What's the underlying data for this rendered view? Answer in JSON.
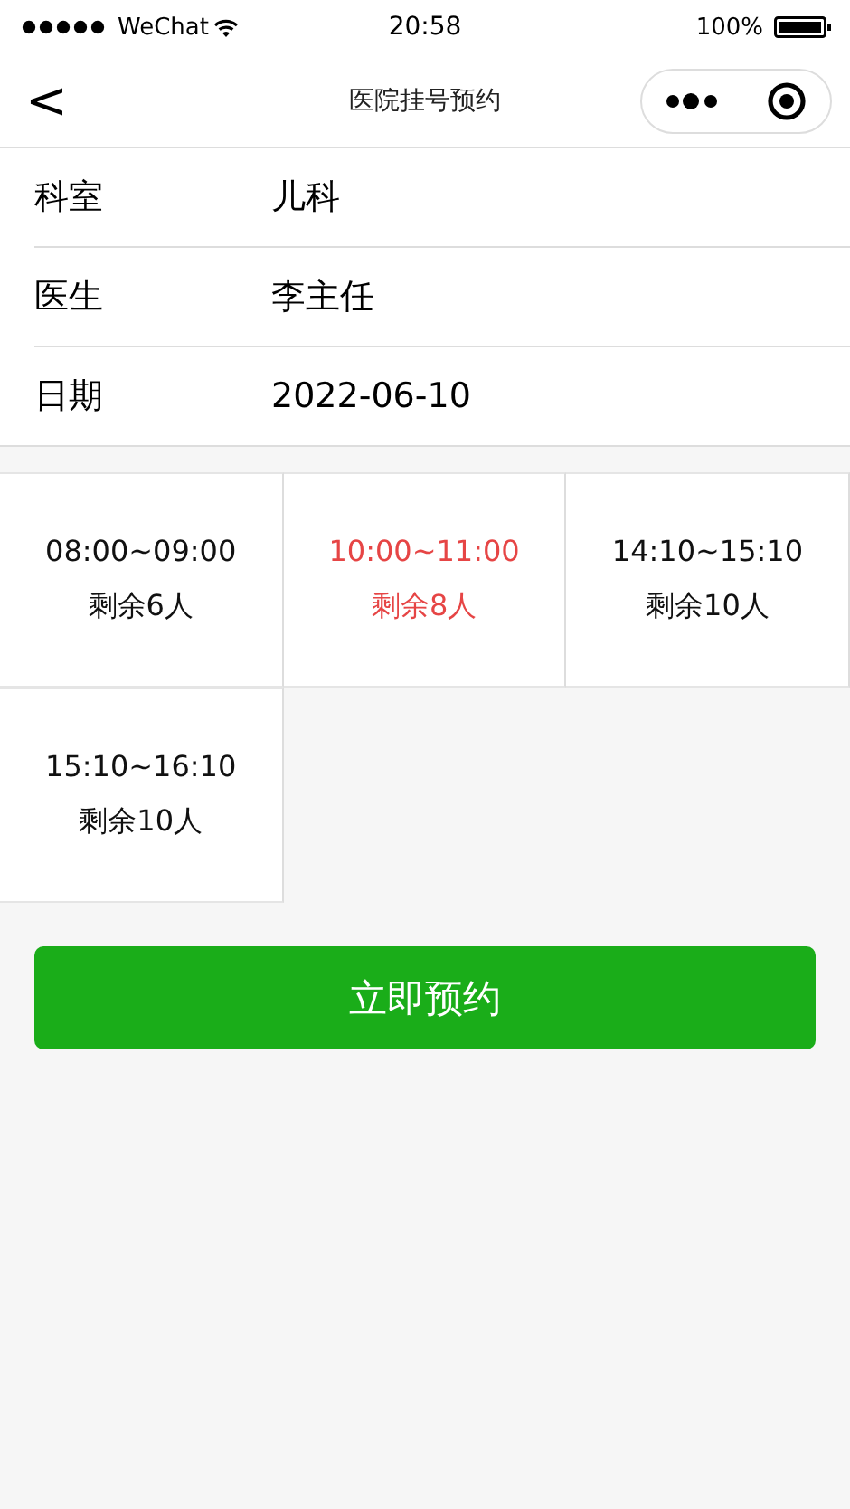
{
  "status_bar": {
    "carrier": "WeChat",
    "time": "20:58",
    "battery": "100%"
  },
  "nav_bar": {
    "back": "<",
    "title": "医院挂号预约"
  },
  "form": [
    {
      "label": "科室",
      "value": "儿科"
    },
    {
      "label": "医生",
      "value": "李主任"
    },
    {
      "label": "日期",
      "value": "2022-06-10"
    }
  ],
  "slots": [
    {
      "time": "08:00~09:00",
      "remaining": "剩余6人",
      "selected": false
    },
    {
      "time": "10:00~11:00",
      "remaining": "剩余8人",
      "selected": true
    },
    {
      "time": "14:10~15:10",
      "remaining": "剩余10人",
      "selected": false
    },
    {
      "time": "15:10~16:10",
      "remaining": "剩余10人",
      "selected": false
    }
  ],
  "submit_button": "立即预约"
}
